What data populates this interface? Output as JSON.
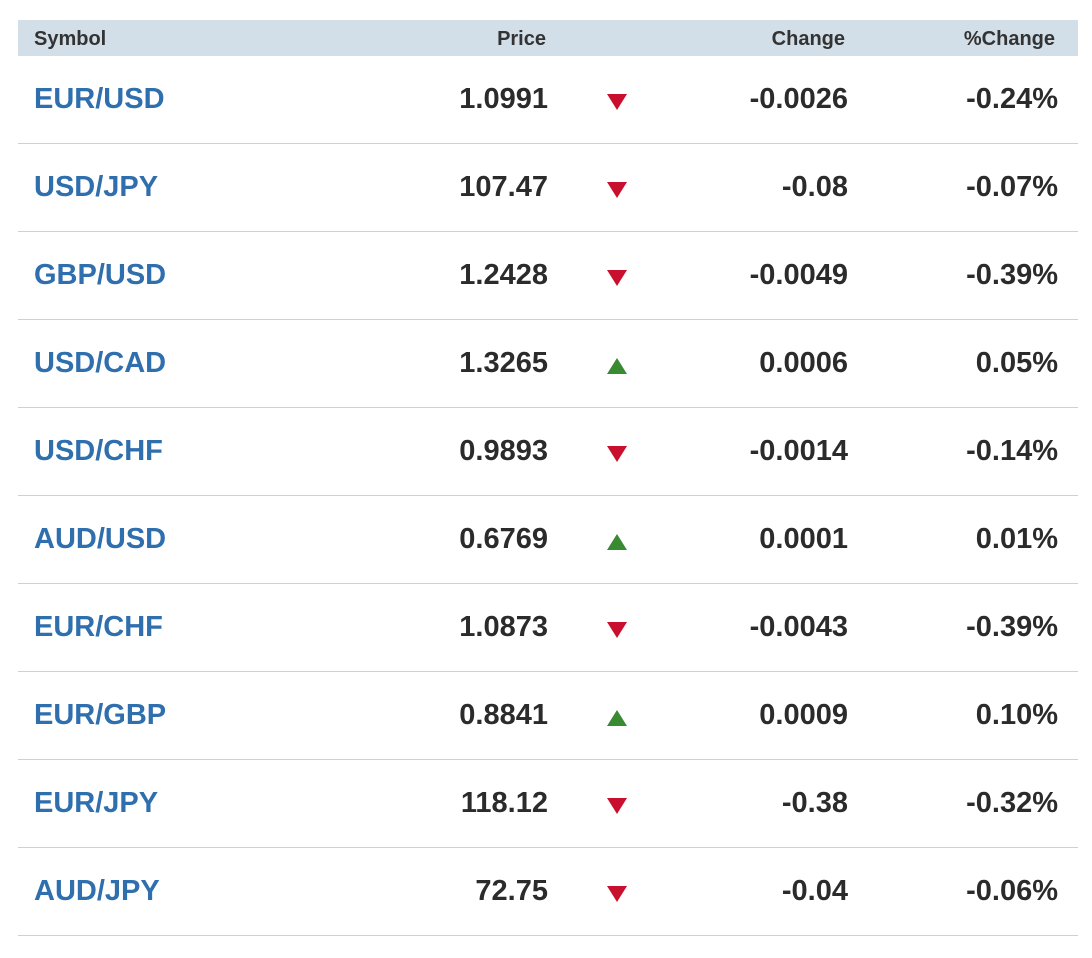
{
  "header": {
    "symbol": "Symbol",
    "price": "Price",
    "change": "Change",
    "pct_change": "%Change"
  },
  "colors": {
    "symbol_link": "#2f6fad",
    "down": "#c8102e",
    "up": "#3a8a34",
    "header_bg": "#d3dfe8"
  },
  "rows": [
    {
      "symbol": "EUR/USD",
      "price": "1.0991",
      "direction": "down",
      "change": "-0.0026",
      "pct_change": "-0.24%"
    },
    {
      "symbol": "USD/JPY",
      "price": "107.47",
      "direction": "down",
      "change": "-0.08",
      "pct_change": "-0.07%"
    },
    {
      "symbol": "GBP/USD",
      "price": "1.2428",
      "direction": "down",
      "change": "-0.0049",
      "pct_change": "-0.39%"
    },
    {
      "symbol": "USD/CAD",
      "price": "1.3265",
      "direction": "up",
      "change": "0.0006",
      "pct_change": "0.05%"
    },
    {
      "symbol": "USD/CHF",
      "price": "0.9893",
      "direction": "down",
      "change": "-0.0014",
      "pct_change": "-0.14%"
    },
    {
      "symbol": "AUD/USD",
      "price": "0.6769",
      "direction": "up",
      "change": "0.0001",
      "pct_change": "0.01%"
    },
    {
      "symbol": "EUR/CHF",
      "price": "1.0873",
      "direction": "down",
      "change": "-0.0043",
      "pct_change": "-0.39%"
    },
    {
      "symbol": "EUR/GBP",
      "price": "0.8841",
      "direction": "up",
      "change": "0.0009",
      "pct_change": "0.10%"
    },
    {
      "symbol": "EUR/JPY",
      "price": "118.12",
      "direction": "down",
      "change": "-0.38",
      "pct_change": "-0.32%"
    },
    {
      "symbol": "AUD/JPY",
      "price": "72.75",
      "direction": "down",
      "change": "-0.04",
      "pct_change": "-0.06%"
    }
  ]
}
